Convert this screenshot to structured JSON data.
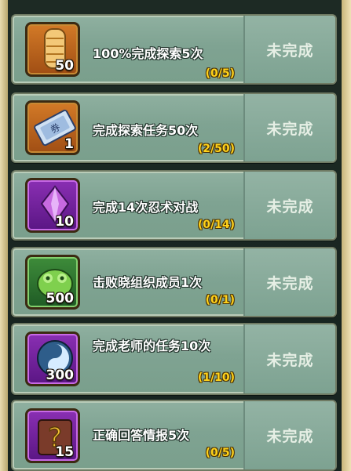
{
  "quests": [
    {
      "title": "100%完成探索5次",
      "progress": "(0/5)",
      "status": "未完成",
      "reward_count": "50",
      "icon": "scroll-icon",
      "icon_color": "#c9722a"
    },
    {
      "title": "完成探索任务50次",
      "progress": "(2/50)",
      "status": "未完成",
      "reward_count": "1",
      "icon": "ticket-icon",
      "icon_color": "#c9722a"
    },
    {
      "title": "完成14次忍术对战",
      "progress": "(0/14)",
      "status": "未完成",
      "reward_count": "10",
      "icon": "crystal-icon",
      "icon_color": "#7a2aa8"
    },
    {
      "title": "击败晓组织成员1次",
      "progress": "(0/1)",
      "status": "未完成",
      "reward_count": "500",
      "icon": "green-toad-icon",
      "icon_color": "#3a8a39"
    },
    {
      "title": "完成老师的任务10次",
      "progress": "(1/10)",
      "status": "未完成",
      "reward_count": "300",
      "icon": "yin-yang-orb-icon",
      "icon_color": "#7a2aa8"
    },
    {
      "title": "正确回答情报5次",
      "progress": "(0/5)",
      "status": "未完成",
      "reward_count": "15",
      "icon": "question-book-icon",
      "icon_color": "#7a2aa8"
    }
  ]
}
